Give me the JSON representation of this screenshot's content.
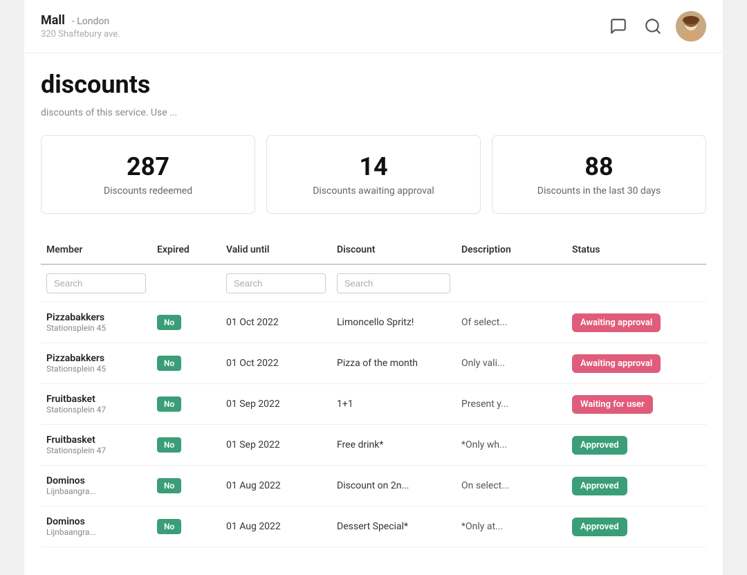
{
  "header": {
    "mall_name": "Mall",
    "mall_location": "- London",
    "mall_address": "320 Shaftebury ave.",
    "avatar_icon": "👤"
  },
  "page": {
    "title": "discounts",
    "description": "discounts of this service. Use ..."
  },
  "stats": [
    {
      "number": "287",
      "label": "Discounts redeemed"
    },
    {
      "number": "14",
      "label": "Discounts awaiting approval"
    },
    {
      "number": "88",
      "label": "Discounts in the last 30 days"
    }
  ],
  "table": {
    "columns": [
      "Member",
      "Expired",
      "Valid until",
      "Discount",
      "Description",
      "Status"
    ],
    "filters": {
      "member_placeholder": "Search",
      "valid_placeholder": "Search",
      "discount_placeholder": "Search"
    },
    "rows": [
      {
        "member_name": "Pizzabakkers",
        "member_address": "Stationsplein 45",
        "expired": "No",
        "valid_until": "01 Oct 2022",
        "discount": "Limoncello Spritz!",
        "description": "Of select...",
        "status": "Awaiting approval",
        "status_type": "awaiting"
      },
      {
        "member_name": "Pizzabakkers",
        "member_address": "Stationsplein 45",
        "expired": "No",
        "valid_until": "01 Oct 2022",
        "discount": "Pizza of the month",
        "description": "Only vali...",
        "status": "Awaiting approval",
        "status_type": "awaiting"
      },
      {
        "member_name": "Fruitbasket",
        "member_address": "Stationsplein 47",
        "expired": "No",
        "valid_until": "01 Sep 2022",
        "discount": "1+1",
        "description": "Present y...",
        "status": "Waiting for user",
        "status_type": "waiting"
      },
      {
        "member_name": "Fruitbasket",
        "member_address": "Stationsplein 47",
        "expired": "No",
        "valid_until": "01 Sep 2022",
        "discount": "Free drink*",
        "description": "*Only wh...",
        "status": "Approved",
        "status_type": "approved"
      },
      {
        "member_name": "Dominos",
        "member_address": "Lijnbaangra...",
        "expired": "No",
        "valid_until": "01 Aug 2022",
        "discount": "Discount on 2n...",
        "description": "On select...",
        "status": "Approved",
        "status_type": "approved"
      },
      {
        "member_name": "Dominos",
        "member_address": "Lijnbaangra...",
        "expired": "No",
        "valid_until": "01 Aug 2022",
        "discount": "Dessert Special*",
        "description": "*Only at...",
        "status": "Approved",
        "status_type": "approved"
      }
    ]
  }
}
